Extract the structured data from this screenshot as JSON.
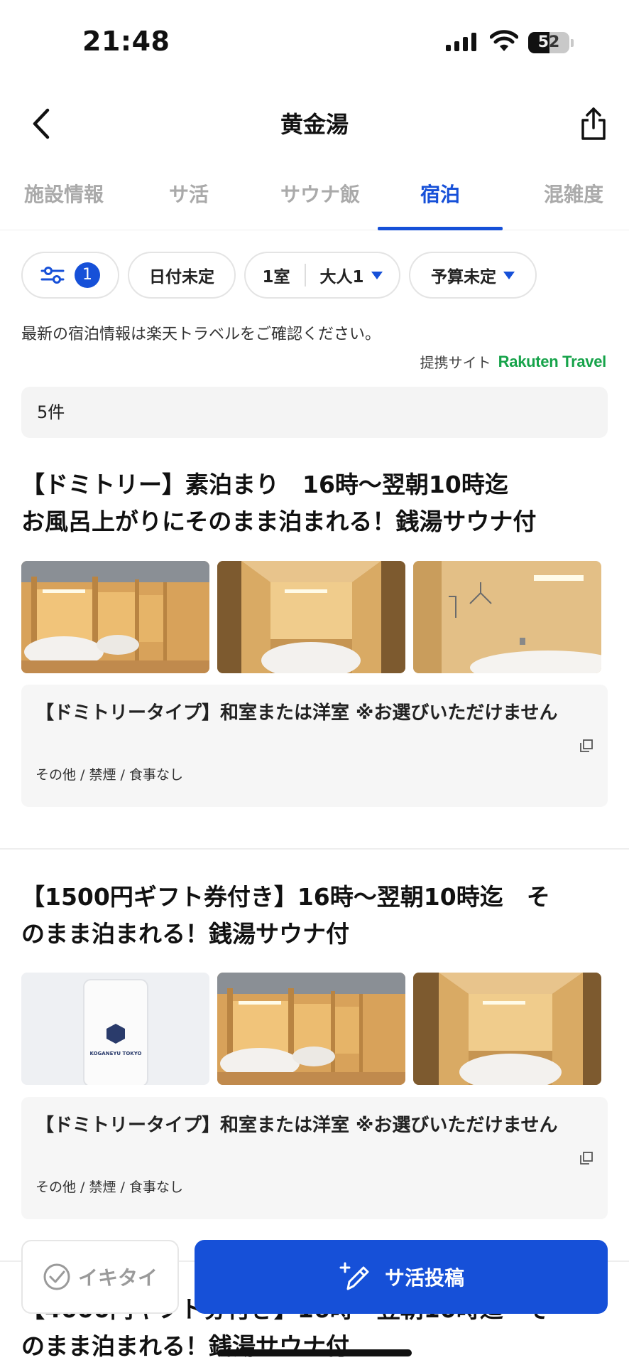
{
  "status_bar": {
    "time": "21:48",
    "battery": "52",
    "battery_level": 0.52
  },
  "header": {
    "title": "黄金湯"
  },
  "tabs": [
    {
      "label": "施設情報",
      "active": false
    },
    {
      "label": "サ活",
      "active": false
    },
    {
      "label": "サウナ飯",
      "active": false
    },
    {
      "label": "宿泊",
      "active": true
    },
    {
      "label": "混雑度",
      "active": false
    }
  ],
  "filters": {
    "filter_count": "1",
    "date": "日付未定",
    "rooms": "1室",
    "adults": "大人1",
    "budget": "予算未定"
  },
  "notice": "最新の宿泊情報は楽天トラベルをご確認ください。",
  "partner": {
    "label": "提携サイト",
    "logo_text": "Rakuten Travel"
  },
  "results_count": "5件",
  "plans": [
    {
      "title_line1": "【ドミトリー】素泊まり　16時〜翌朝10時迄",
      "title_line2": "お風呂上がりにそのまま泊まれる！銭湯サウナ付",
      "room_title": "【ドミトリータイプ】和室または洋室 ※お選びいただけません",
      "room_meta": "その他 / 禁煙 / 食事なし"
    },
    {
      "title_line1": "【1500円ギフト券付き】16時〜翌朝10時迄　そ",
      "title_line2": "のまま泊まれる！銭湯サウナ付",
      "room_title": "【ドミトリータイプ】和室または洋室 ※お選びいただけません",
      "room_meta": "その他 / 禁煙 / 食事なし",
      "towel_logo": "KOGANEYU TOKYO"
    },
    {
      "title_line1": "【4000円ギフト券付き】16時〜翌朝10時迄　そ",
      "title_line2": "のまま泊まれる！銭湯サウナ付"
    }
  ],
  "actions": {
    "ikitai": "イキタイ",
    "post": "サ活投稿"
  },
  "colors": {
    "accent": "#1650d8",
    "rakuten": "#16a34a"
  }
}
